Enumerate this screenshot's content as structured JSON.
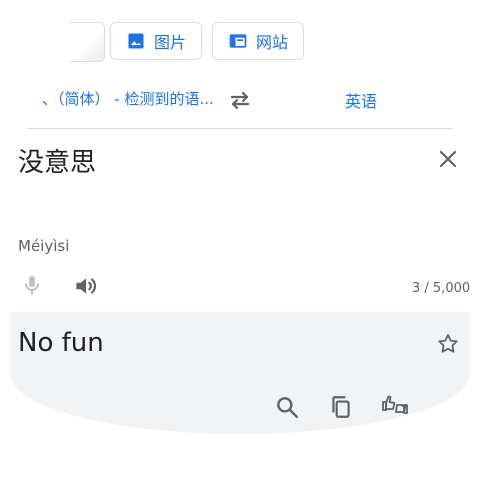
{
  "tabs": {
    "images_label": "图片",
    "websites_label": "网站"
  },
  "language": {
    "source": "、（简体） - 检测到的语...",
    "target": "英语"
  },
  "input": {
    "text": "没意思",
    "romanization": "Méiyìsi",
    "char_count": "3 / 5,000"
  },
  "translation": {
    "text": "No fun"
  },
  "colors": {
    "accent": "#1a73e8",
    "icon_gray": "#5f6368",
    "card_bg": "#f1f3f4"
  }
}
